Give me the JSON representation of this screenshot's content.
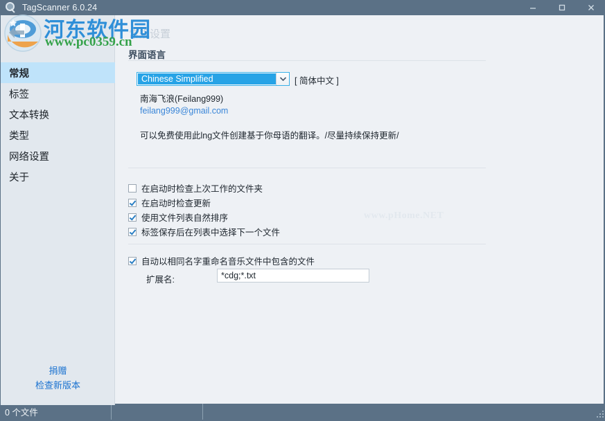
{
  "window": {
    "title": "TagScanner 6.0.24",
    "icon": "magnifier-icon",
    "minimize_label": "–",
    "maximize_label": "☐",
    "close_label": "✕"
  },
  "watermark": {
    "site_name": "河东软件园",
    "site_url": "www.pc0359.cn",
    "overlay_text": "www.pHome.NET",
    "brand_blue": "#2f8fd8",
    "brand_green": "#35a24a"
  },
  "sidebar": {
    "items": [
      {
        "label": "常规",
        "active": true
      },
      {
        "label": "标签",
        "active": false
      },
      {
        "label": "文本转换",
        "active": false
      },
      {
        "label": "类型",
        "active": false
      },
      {
        "label": "网络设置",
        "active": false
      },
      {
        "label": "关于",
        "active": false
      }
    ],
    "links": [
      {
        "label": "捐赠"
      },
      {
        "label": "检查新版本"
      }
    ],
    "selection_color": "#bfe3fa",
    "background": "#e2e8ee"
  },
  "main": {
    "page_title": "常规设置",
    "section_title": "界面语言",
    "language": {
      "selected": "Chinese Simplified",
      "native_name": "[ 简体中文 ]",
      "translator": "南海飞浪(Feilang999)",
      "translator_email": "feilang999@gmail.com",
      "note": "可以免费使用此lng文件创建基于你母语的翻译。/尽量持续保持更新/",
      "dropdown_icon": "chevron-down-icon",
      "highlight_color": "#27a3e6"
    },
    "options": [
      {
        "label": "在启动时检查上次工作的文件夹",
        "checked": false
      },
      {
        "label": "在启动时检查更新",
        "checked": true
      },
      {
        "label": "使用文件列表自然排序",
        "checked": true
      },
      {
        "label": "标签保存后在列表中选择下一个文件",
        "checked": true
      }
    ],
    "rename": {
      "label": "自动以相同名字重命名音乐文件中包含的文件",
      "checked": true,
      "ext_label": "扩展名:",
      "ext_value": "*cdg;*.txt",
      "ext_placeholder": "*cdg;*.txt"
    }
  },
  "statusbar": {
    "file_count": "0 个文件",
    "cell2": "",
    "cell3": "",
    "background": "#5b7186"
  }
}
